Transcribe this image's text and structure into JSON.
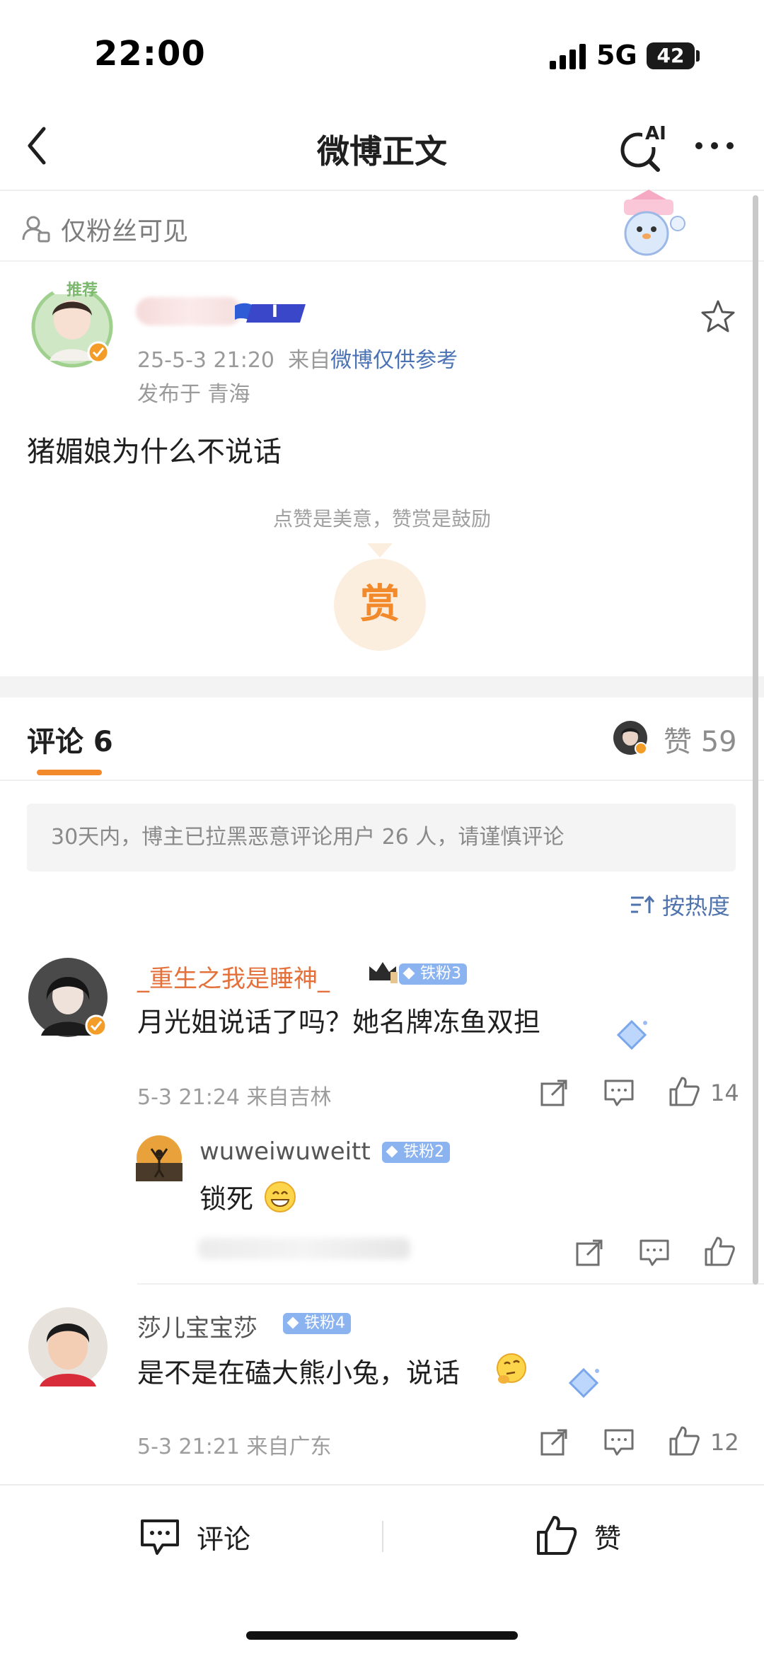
{
  "status_bar": {
    "time": "22:00",
    "network": "5G",
    "battery": "42"
  },
  "nav": {
    "title": "微博正文",
    "ai_label": "AI"
  },
  "visibility": {
    "label": "仅粉丝可见"
  },
  "post": {
    "recommend_tag": "推荐",
    "fan_badge_level": "I",
    "date_time": "25-5-3 21:20",
    "source_prefix": "来自",
    "source": "微博仅供参考",
    "location": "发布于 青海",
    "text": "猪媚娘为什么不说话",
    "reward_tip": "点赞是美意，赞赏是鼓励",
    "reward_label": "赏"
  },
  "comments_header": {
    "tab_label": "评论 6",
    "like_label": "赞",
    "like_count": "59"
  },
  "notice": "30天内，博主已拉黑恶意评论用户 26 人，请谨慎评论",
  "sort_label": "按热度",
  "comments": [
    {
      "username": "_重生之我是睡神_",
      "badge": "铁粉3",
      "text": "月光姐说话了吗？她名牌冻鱼双担",
      "meta": "5-3 21:24  来自吉林",
      "likes": "14",
      "replies": [
        {
          "username": "wuweiwuweitt",
          "badge": "铁粉2",
          "text": "锁死"
        }
      ]
    },
    {
      "username": "莎儿宝宝莎",
      "badge": "铁粉4",
      "text": "是不是在磕大熊小兔，说话",
      "meta": "5-3 21:21  来自广东",
      "likes": "12"
    }
  ],
  "bottom_bar": {
    "comment_label": "评论",
    "like_label": "赞"
  },
  "colors": {
    "accent": "#f28a2c",
    "link": "#4a72b5",
    "vip_name": "#e4713b",
    "fan_badge": "#8bb3f0"
  }
}
